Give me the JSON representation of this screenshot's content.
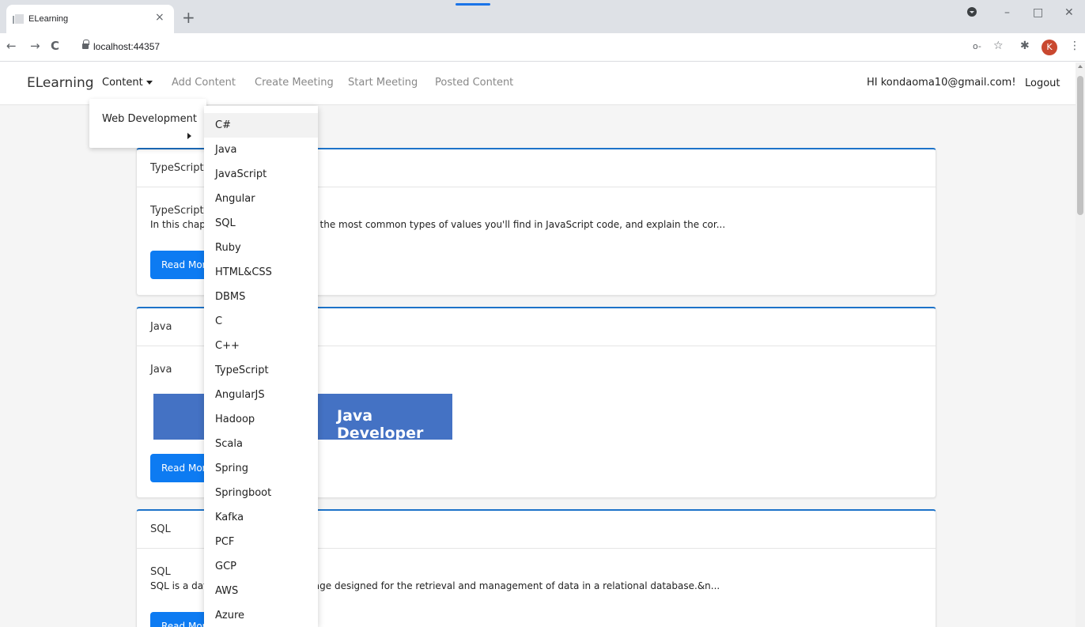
{
  "browser": {
    "tab_title": "ELearning",
    "tab_close": "×",
    "new_tab": "+",
    "url": "localhost:44357",
    "back": "←",
    "forward": "→",
    "reload": "C",
    "minimize": "–",
    "restore": "□",
    "close": "✕",
    "key_icon": "o-",
    "star_icon": "☆",
    "ext_icon": "✱",
    "menu_icon": "⋮",
    "avatar_letter": "K"
  },
  "navbar": {
    "brand": "ELearning",
    "content": "Content",
    "add_content": "Add Content",
    "create_meeting": "Create Meeting",
    "start_meeting": "Start Meeting",
    "posted_content": "Posted Content",
    "greeting": "HI kondaoma10@gmail.com!",
    "logout": "Logout"
  },
  "dropdown": {
    "category": "Web Development",
    "items": [
      "C#",
      "Java",
      "JavaScript",
      "Angular",
      "SQL",
      "Ruby",
      "HTML&CSS",
      "DBMS",
      "C",
      "C++",
      "TypeScript",
      "AngularJS",
      "Hadoop",
      "Scala",
      "Spring",
      "Springboot",
      "Kafka",
      "PCF",
      "GCP",
      "AWS",
      "Azure"
    ]
  },
  "cards": [
    {
      "header": "TypeScript",
      "subtitle": "TypeScript",
      "text": "In this chapter, we'll cover some of the most common types of values you'll find in JavaScript code, and explain the cor...",
      "button": "Read More"
    },
    {
      "header": "Java",
      "subtitle": "Java",
      "banner_text": "Java Developer",
      "button": "Read More"
    },
    {
      "header": "SQL",
      "subtitle": "SQL",
      "text": "SQL is a database computer language designed for the retrieval and management of data in a relational database.&n...",
      "button": "Read More"
    }
  ],
  "colors": {
    "accent": "#0d7bf2",
    "card_border_top": "#1d73c9",
    "banner": "#4472c4",
    "avatar": "#c9482f"
  }
}
